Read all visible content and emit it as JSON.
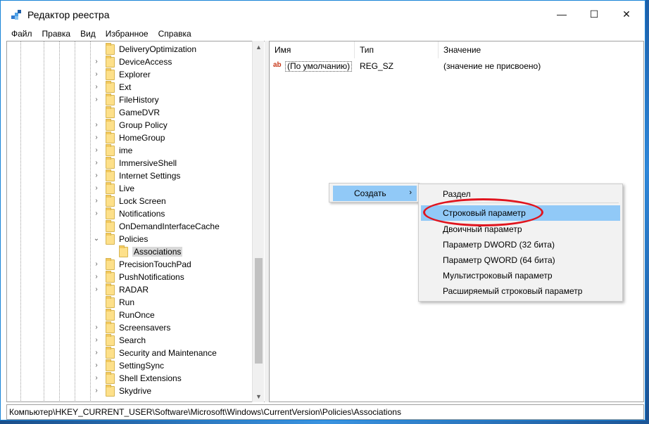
{
  "window": {
    "title": "Редактор реестра",
    "minimize_glyph": "—",
    "maximize_glyph": "☐",
    "close_glyph": "✕"
  },
  "menu": {
    "items": [
      "Файл",
      "Правка",
      "Вид",
      "Избранное",
      "Справка"
    ]
  },
  "tree": {
    "items": [
      {
        "label": "DeliveryOptimization",
        "expandable": false
      },
      {
        "label": "DeviceAccess",
        "expandable": true
      },
      {
        "label": "Explorer",
        "expandable": true
      },
      {
        "label": "Ext",
        "expandable": true
      },
      {
        "label": "FileHistory",
        "expandable": true
      },
      {
        "label": "GameDVR",
        "expandable": false
      },
      {
        "label": "Group Policy",
        "expandable": true
      },
      {
        "label": "HomeGroup",
        "expandable": true
      },
      {
        "label": "ime",
        "expandable": true
      },
      {
        "label": "ImmersiveShell",
        "expandable": true
      },
      {
        "label": "Internet Settings",
        "expandable": true
      },
      {
        "label": "Live",
        "expandable": true
      },
      {
        "label": "Lock Screen",
        "expandable": true
      },
      {
        "label": "Notifications",
        "expandable": true
      },
      {
        "label": "OnDemandInterfaceCache",
        "expandable": false
      },
      {
        "label": "Policies",
        "expandable": true,
        "expanded": true
      },
      {
        "label": "Associations",
        "expandable": false,
        "selected": true,
        "child": true
      },
      {
        "label": "PrecisionTouchPad",
        "expandable": true
      },
      {
        "label": "PushNotifications",
        "expandable": true
      },
      {
        "label": "RADAR",
        "expandable": true
      },
      {
        "label": "Run",
        "expandable": false
      },
      {
        "label": "RunOnce",
        "expandable": false
      },
      {
        "label": "Screensavers",
        "expandable": true
      },
      {
        "label": "Search",
        "expandable": true
      },
      {
        "label": "Security and Maintenance",
        "expandable": true
      },
      {
        "label": "SettingSync",
        "expandable": true
      },
      {
        "label": "Shell Extensions",
        "expandable": true
      },
      {
        "label": "Skydrive",
        "expandable": true
      }
    ]
  },
  "list": {
    "columns": {
      "name": "Имя",
      "type": "Тип",
      "value": "Значение"
    },
    "rows": [
      {
        "icon": "ab",
        "name": "(По умолчанию)",
        "type": "REG_SZ",
        "value": "(значение не присвоено)"
      }
    ]
  },
  "context_menu": {
    "create_label": "Создать",
    "submenu_arrow": "›"
  },
  "submenu": {
    "items": [
      {
        "label": "Раздел"
      },
      {
        "label": "Строковый параметр",
        "highlighted": true
      },
      {
        "label": "Двоичный параметр"
      },
      {
        "label": "Параметр DWORD (32 бита)"
      },
      {
        "label": "Параметр QWORD (64 бита)"
      },
      {
        "label": "Мультистроковый параметр"
      },
      {
        "label": "Расширяемый строковый параметр"
      }
    ]
  },
  "status": {
    "path": "Компьютер\\HKEY_CURRENT_USER\\Software\\Microsoft\\Windows\\CurrentVersion\\Policies\\Associations"
  },
  "colors": {
    "highlight": "#91c9f7",
    "annotation_ring": "#e0141e",
    "window_border": "#1883d7"
  }
}
